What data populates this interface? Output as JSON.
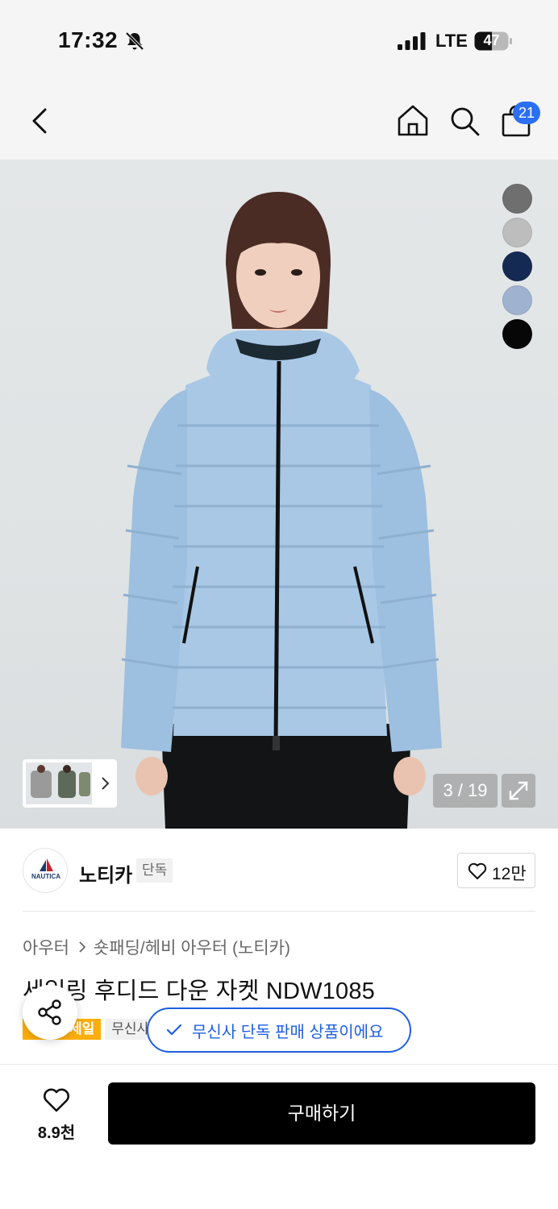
{
  "status_bar": {
    "time": "17:32",
    "network": "LTE",
    "battery": "47"
  },
  "nav": {
    "cart_count": "21",
    "icons": [
      "back-icon",
      "home-icon",
      "search-icon",
      "cart-icon"
    ]
  },
  "gallery": {
    "counter": "3 / 19",
    "swatch_colors": [
      "#6f6f6f",
      "#bdbdbd",
      "#142a52",
      "#9fb2cf",
      "#070707"
    ],
    "jacket_color": "#a9c8e6"
  },
  "brand": {
    "logo_text": "NAUTICA",
    "name": "노티카",
    "exclusive_tag": "단독",
    "likes": "12만"
  },
  "product": {
    "breadcrumb": [
      "아우터",
      "숏패딩/헤비 아우터 (노티카)"
    ],
    "title": "세일링 후디드 다운 자켓 NDW1085",
    "sale_badge": "세일",
    "musinsa_badge": "무신사"
  },
  "toast": {
    "text": "무신사 단독 판매 상품이에요"
  },
  "bottom_bar": {
    "like_count": "8.9천",
    "buy_label": "구매하기"
  },
  "colors": {
    "accent_blue": "#1f5fe0",
    "badge_blue": "#2b6ff3",
    "sale_orange": "#fcae0c"
  }
}
